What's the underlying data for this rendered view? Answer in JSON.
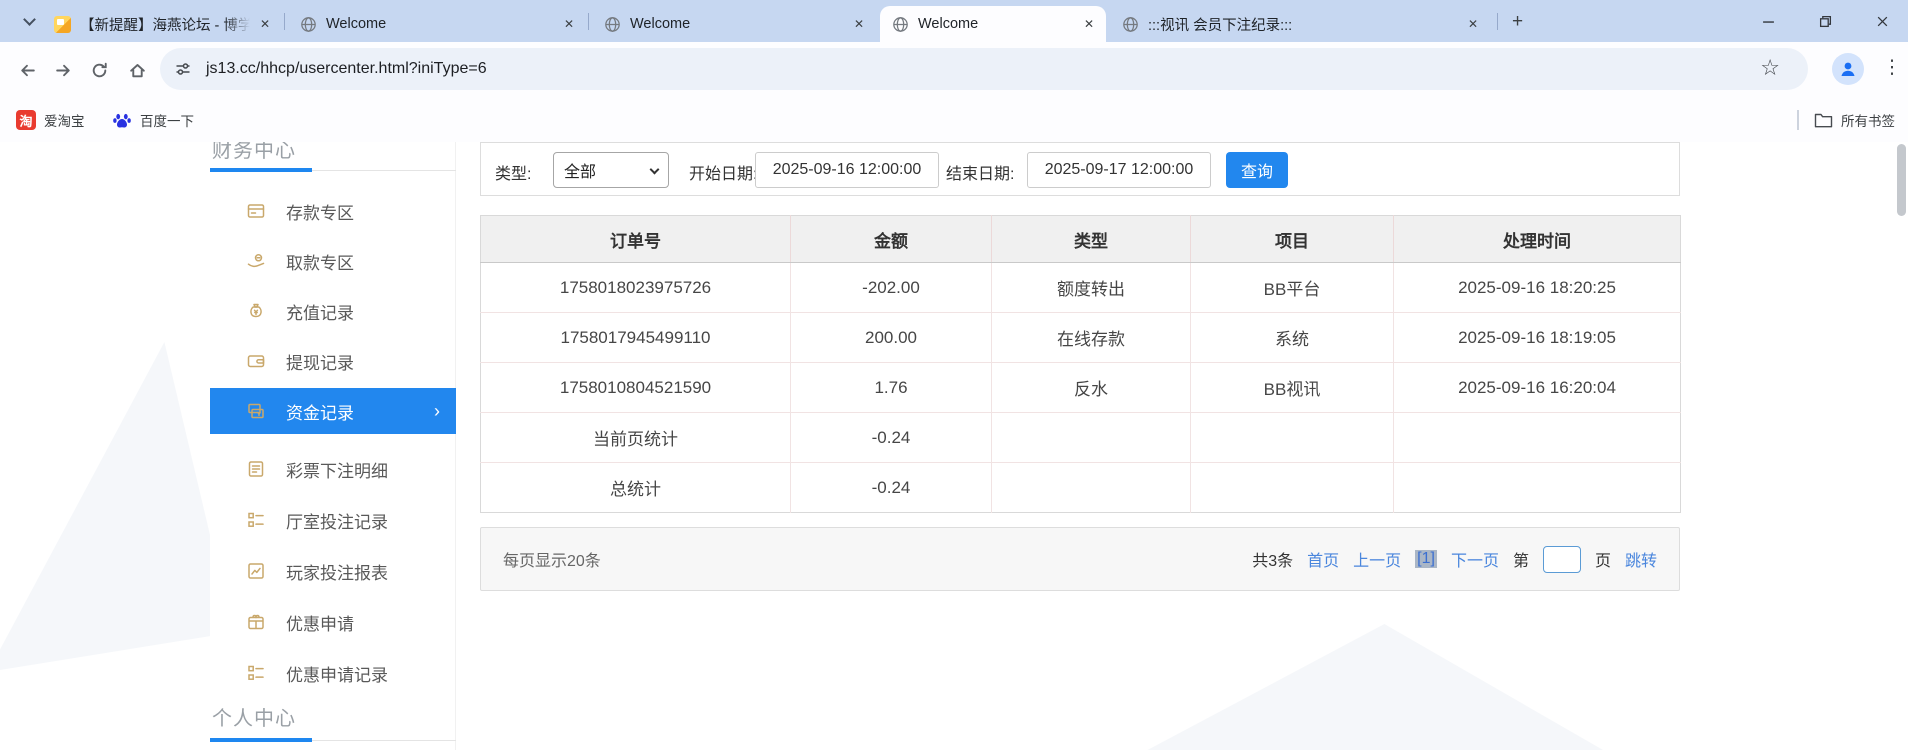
{
  "browser": {
    "tabs": [
      {
        "title": "【新提醒】海燕论坛 - 博学交流",
        "active": false,
        "favicon": "forum"
      },
      {
        "title": "Welcome",
        "active": false,
        "favicon": "globe"
      },
      {
        "title": "Welcome",
        "active": false,
        "favicon": "globe"
      },
      {
        "title": "Welcome",
        "active": true,
        "favicon": "globe"
      },
      {
        "title": ":::视讯 会员下注纪录:::",
        "active": false,
        "favicon": "globe"
      }
    ],
    "url": "js13.cc/hhcp/usercenter.html?iniType=6",
    "bookmarks": {
      "items": [
        {
          "label": "爱淘宝"
        },
        {
          "label": "百度一下"
        }
      ],
      "all_label": "所有书签"
    }
  },
  "icons": {
    "close": "✕",
    "plus": "+",
    "star": "☆",
    "kebab": "⋮",
    "item_chevron": "›",
    "taobao_char": "淘"
  },
  "sidebar": {
    "section_top": "财务中心",
    "section_bottom": "个人中心",
    "items": [
      {
        "label": "存款专区",
        "icon": "deposit-card-icon",
        "active": false
      },
      {
        "label": "取款专区",
        "icon": "withdraw-hand-icon",
        "active": false
      },
      {
        "label": "充值记录",
        "icon": "moneybag-icon",
        "active": false
      },
      {
        "label": "提现记录",
        "icon": "wallet-icon",
        "active": false
      },
      {
        "label": "资金记录",
        "icon": "funds-cards-icon",
        "active": true
      },
      {
        "label": "彩票下注明细",
        "icon": "lottery-detail-icon",
        "active": false
      },
      {
        "label": "厅室投注记录",
        "icon": "hall-bet-list-icon",
        "active": false
      },
      {
        "label": "玩家投注报表",
        "icon": "player-report-chart-icon",
        "active": false
      },
      {
        "label": "优惠申请",
        "icon": "promo-apply-gift-icon",
        "active": false
      },
      {
        "label": "优惠申请记录",
        "icon": "promo-record-list-icon",
        "active": false
      }
    ]
  },
  "filters": {
    "type_label": "类型:",
    "type_value": "全部",
    "start_label": "开始日期:",
    "start_value": "2025-09-16 12:00:00",
    "end_label": "结束日期:",
    "end_value": "2025-09-17 12:00:00",
    "search_button": "查询"
  },
  "table": {
    "headers": [
      "订单号",
      "金额",
      "类型",
      "项目",
      "处理时间"
    ],
    "rows": [
      [
        "1758018023975726",
        "-202.00",
        "额度转出",
        "BB平台",
        "2025-09-16 18:20:25"
      ],
      [
        "1758017945499110",
        "200.00",
        "在线存款",
        "系统",
        "2025-09-16 18:19:05"
      ],
      [
        "1758010804521590",
        "1.76",
        "反水",
        "BB视讯",
        "2025-09-16 16:20:04"
      ],
      [
        "当前页统计",
        "-0.24",
        "",
        "",
        ""
      ],
      [
        "总统计",
        "-0.24",
        "",
        "",
        ""
      ]
    ]
  },
  "pagination": {
    "per_page": "每页显示20条",
    "total": "共3条",
    "first": "首页",
    "prev": "上一页",
    "current": "[1]",
    "next": "下一页",
    "page_prefix": "第",
    "page_suffix": "页",
    "jump": "跳转"
  },
  "colors": {
    "accent_blue": "#2287ee",
    "sidebar_icon_gold": "#c9a86b",
    "link_blue": "#4a86dd",
    "tabstrip_blue": "#c6d7f1"
  }
}
